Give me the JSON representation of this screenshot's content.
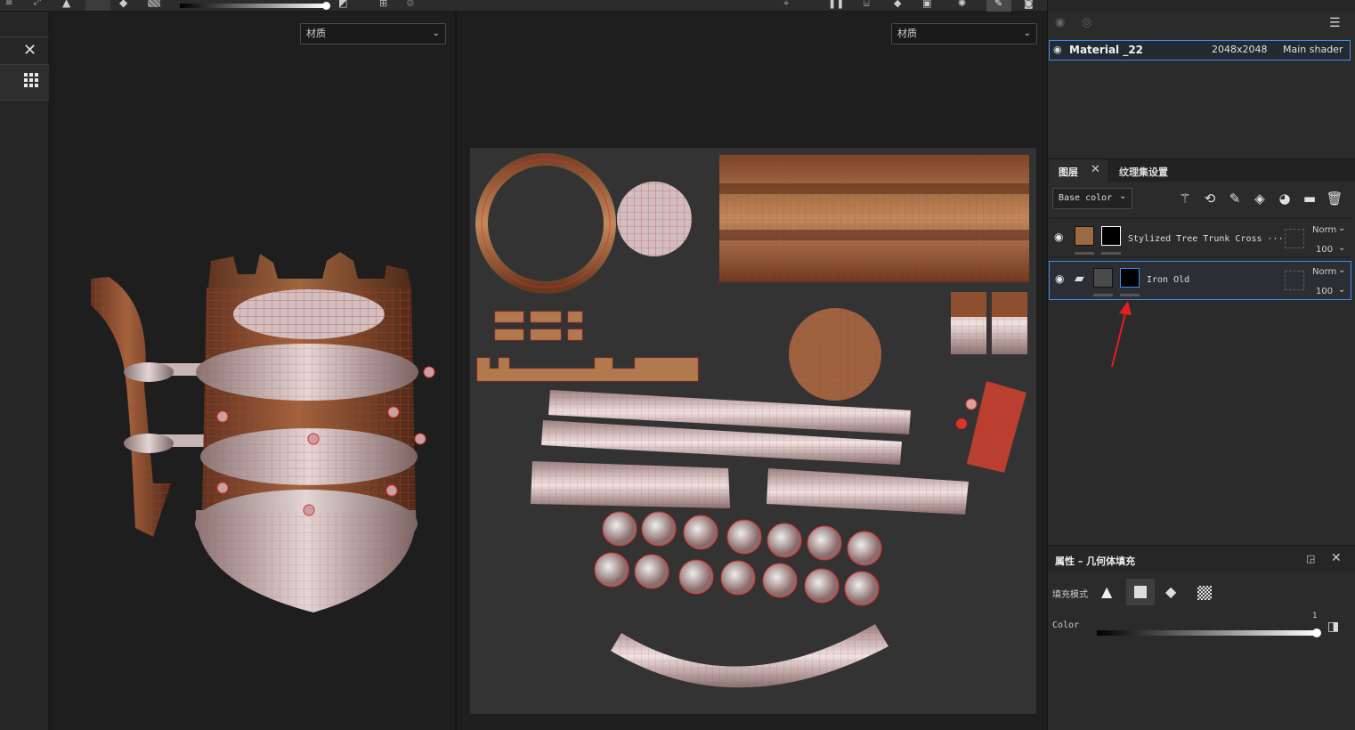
{
  "viewport": {
    "left_dropdown": "材质",
    "right_dropdown": "材质"
  },
  "texture_sets": {
    "name": "Material _22",
    "resolution": "2048x2048",
    "shader": "Main shader"
  },
  "layers_panel": {
    "tab_layers": "图层",
    "tab_texset": "纹理集设置",
    "channel": "Base color",
    "layers": [
      {
        "name": "Stylized Tree Trunk Cross ···",
        "blend": "Norm",
        "opacity": "100"
      },
      {
        "name": "Iron Old",
        "blend": "Norm",
        "opacity": "100"
      }
    ]
  },
  "properties_panel": {
    "title": "属性 – 几何体填充",
    "fill_mode_label": "填充模式",
    "color_label": "Color",
    "color_value": "1"
  },
  "colors": {
    "accent_blue": "#3d8ee6",
    "wire_red": "#e0302a",
    "arrow_red": "#e02020",
    "wood": "#8a5235",
    "metal": "#c8b6b6"
  }
}
